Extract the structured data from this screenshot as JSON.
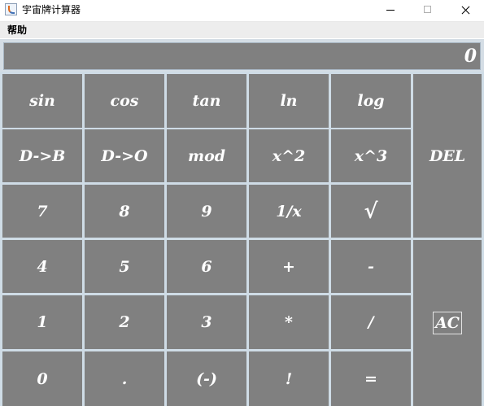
{
  "window": {
    "title": "宇宙牌计算器"
  },
  "menu": {
    "items": [
      "帮助"
    ]
  },
  "display": {
    "value": "0"
  },
  "keys": {
    "sin": "sin",
    "cos": "cos",
    "tan": "tan",
    "ln": "ln",
    "log": "log",
    "d_to_b": "D->B",
    "d_to_o": "D->O",
    "mod": "mod",
    "x_sq": "x^2",
    "x_cube": "x^3",
    "del": "DEL",
    "seven": "7",
    "eight": "8",
    "nine": "9",
    "reciprocal": "1/x",
    "sqrt": "√",
    "four": "4",
    "five": "5",
    "six": "6",
    "plus": "+",
    "minus": "-",
    "one": "1",
    "two": "2",
    "three": "3",
    "multiply": "*",
    "divide": "/",
    "ac": "AC",
    "zero": "0",
    "dot": ".",
    "negate": "(-)",
    "factorial": "!",
    "equals": "="
  },
  "colors": {
    "key_bg": "#808080",
    "key_text": "#ffffff",
    "grid_line": "#cfdce6"
  }
}
